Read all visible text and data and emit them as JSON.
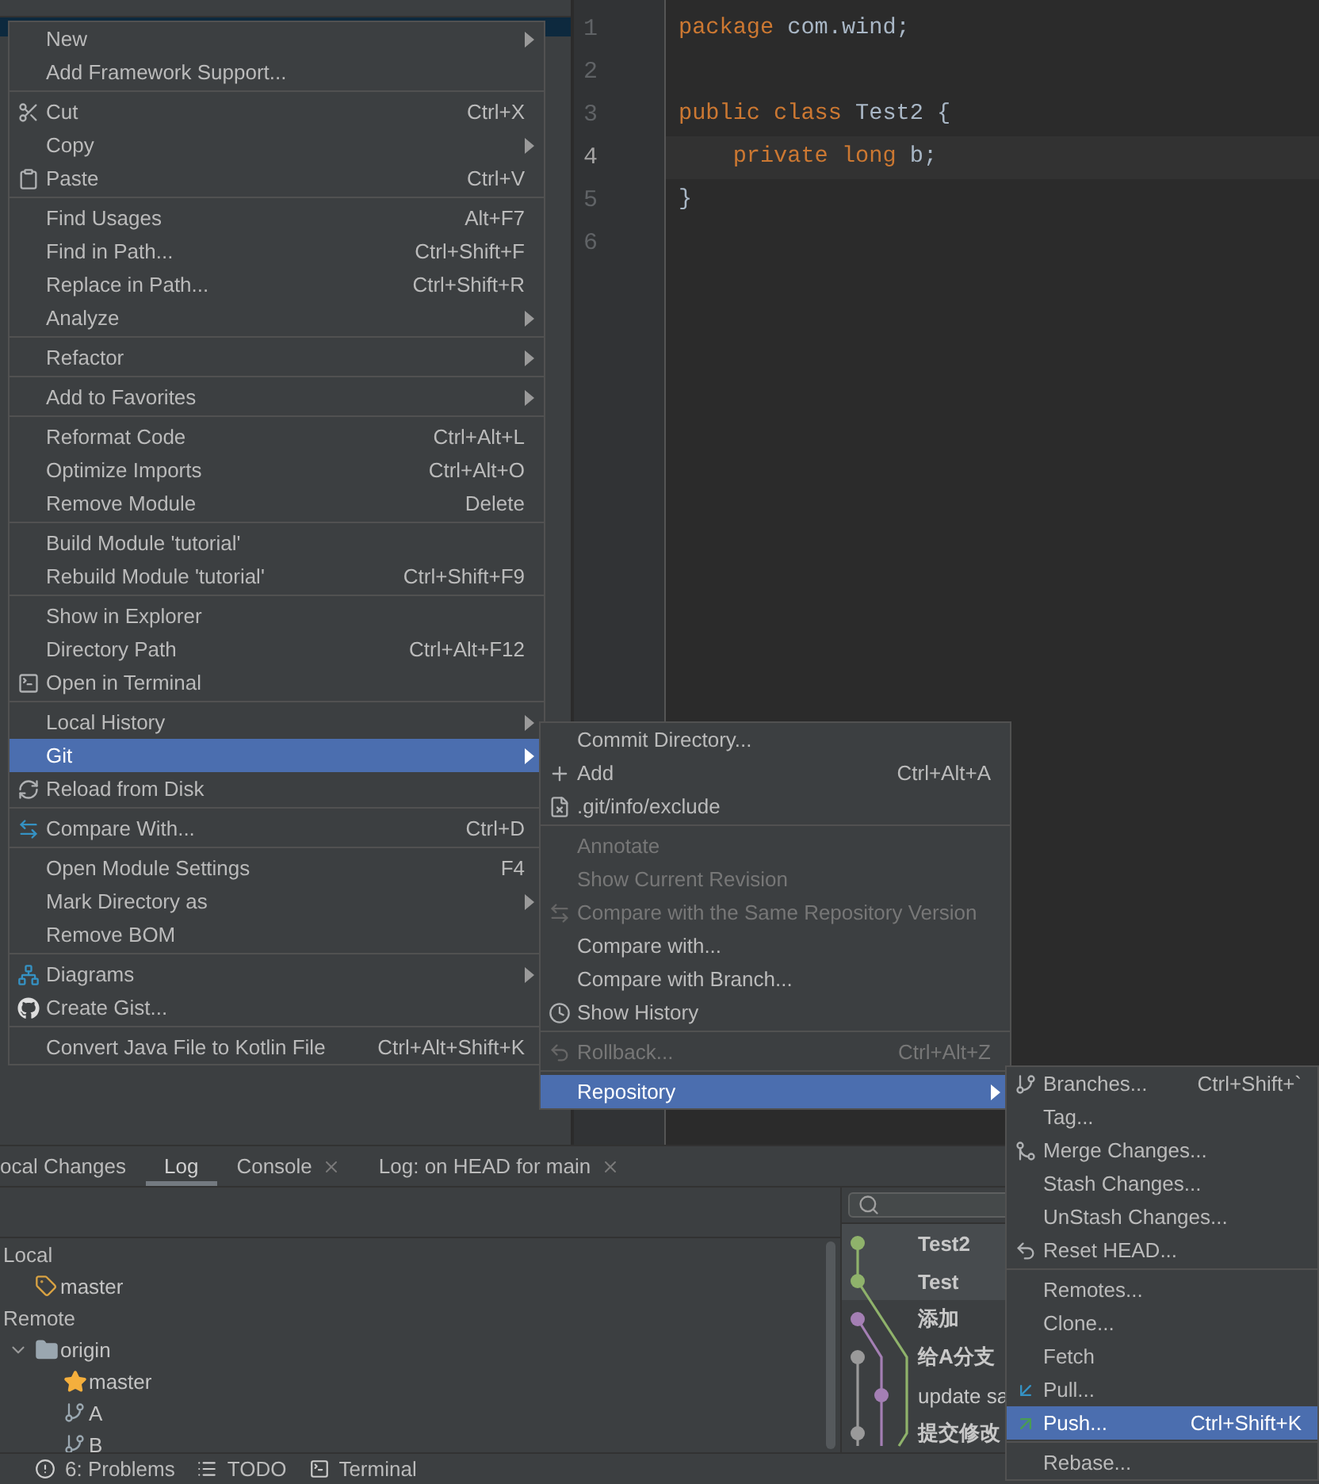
{
  "editor": {
    "lines": [
      {
        "number": "1",
        "current": false,
        "tokens": [
          {
            "kind": "keyword",
            "text": "package"
          },
          {
            "kind": "plain",
            "text": " com.wind;"
          }
        ]
      },
      {
        "number": "2",
        "current": false
      },
      {
        "number": "3",
        "current": false,
        "tokens": [
          {
            "kind": "keyword",
            "text": "public class"
          },
          {
            "kind": "plain",
            "text": " Test2 {"
          }
        ]
      },
      {
        "number": "4",
        "current": true,
        "tokens": [
          {
            "kind": "keyword",
            "text": "    private long"
          },
          {
            "kind": "plain",
            "text": " b;"
          }
        ]
      },
      {
        "number": "5",
        "current": false,
        "tokens": [
          {
            "kind": "plain",
            "text": "}"
          }
        ]
      },
      {
        "number": "6",
        "current": false
      }
    ]
  },
  "menus": [
    {
      "groups": [
        [
          {
            "label": "New",
            "submenu": true,
            "selected": false,
            "disabled": false
          },
          {
            "label": "Add Framework Support...",
            "submenu": false,
            "selected": false,
            "disabled": false
          }
        ],
        [
          {
            "label": "Cut",
            "shortcut": "Ctrl+X",
            "submenu": false,
            "selected": false,
            "disabled": false
          },
          {
            "label": "Copy",
            "submenu": true,
            "selected": false,
            "disabled": false
          },
          {
            "label": "Paste",
            "shortcut": "Ctrl+V",
            "submenu": false,
            "selected": false,
            "disabled": false
          }
        ],
        [
          {
            "label": "Find Usages",
            "shortcut": "Alt+F7",
            "submenu": false,
            "selected": false,
            "disabled": false
          },
          {
            "label": "Find in Path...",
            "shortcut": "Ctrl+Shift+F",
            "submenu": false,
            "selected": false,
            "disabled": false
          },
          {
            "label": "Replace in Path...",
            "shortcut": "Ctrl+Shift+R",
            "submenu": false,
            "selected": false,
            "disabled": false
          },
          {
            "label": "Analyze",
            "submenu": true,
            "selected": false,
            "disabled": false
          }
        ],
        [
          {
            "label": "Refactor",
            "submenu": true,
            "selected": false,
            "disabled": false
          }
        ],
        [
          {
            "label": "Add to Favorites",
            "submenu": true,
            "selected": false,
            "disabled": false
          }
        ],
        [
          {
            "label": "Reformat Code",
            "shortcut": "Ctrl+Alt+L",
            "submenu": false,
            "selected": false,
            "disabled": false
          },
          {
            "label": "Optimize Imports",
            "shortcut": "Ctrl+Alt+O",
            "submenu": false,
            "selected": false,
            "disabled": false
          },
          {
            "label": "Remove Module",
            "shortcut": "Delete",
            "submenu": false,
            "selected": false,
            "disabled": false
          }
        ],
        [
          {
            "label": "Build Module 'tutorial'",
            "submenu": false,
            "selected": false,
            "disabled": false
          },
          {
            "label": "Rebuild Module 'tutorial'",
            "shortcut": "Ctrl+Shift+F9",
            "submenu": false,
            "selected": false,
            "disabled": false
          }
        ],
        [
          {
            "label": "Show in Explorer",
            "submenu": false,
            "selected": false,
            "disabled": false
          },
          {
            "label": "Directory Path",
            "shortcut": "Ctrl+Alt+F12",
            "submenu": false,
            "selected": false,
            "disabled": false
          },
          {
            "label": "Open in Terminal",
            "submenu": false,
            "selected": false,
            "disabled": false
          }
        ],
        [
          {
            "label": "Local History",
            "submenu": true,
            "selected": false,
            "disabled": false
          },
          {
            "label": "Git",
            "submenu": true,
            "selected": true,
            "disabled": false
          },
          {
            "label": "Reload from Disk",
            "submenu": false,
            "selected": false,
            "disabled": false
          }
        ],
        [
          {
            "label": "Compare With...",
            "shortcut": "Ctrl+D",
            "submenu": false,
            "selected": false,
            "disabled": false
          }
        ],
        [
          {
            "label": "Open Module Settings",
            "shortcut": "F4",
            "submenu": false,
            "selected": false,
            "disabled": false
          },
          {
            "label": "Mark Directory as",
            "submenu": true,
            "selected": false,
            "disabled": false
          },
          {
            "label": "Remove BOM",
            "submenu": false,
            "selected": false,
            "disabled": false
          }
        ],
        [
          {
            "label": "Diagrams",
            "submenu": true,
            "selected": false,
            "disabled": false
          },
          {
            "label": "Create Gist...",
            "submenu": false,
            "selected": false,
            "disabled": false
          }
        ],
        [
          {
            "label": "Convert Java File to Kotlin File",
            "shortcut": "Ctrl+Alt+Shift+K",
            "submenu": false,
            "selected": false,
            "disabled": false
          }
        ]
      ]
    },
    {
      "groups": [
        [
          {
            "label": "Commit Directory...",
            "submenu": false,
            "selected": false,
            "disabled": false
          },
          {
            "label": "Add",
            "shortcut": "Ctrl+Alt+A",
            "submenu": false,
            "selected": false,
            "disabled": false
          },
          {
            "label": ".git/info/exclude",
            "submenu": false,
            "selected": false,
            "disabled": false
          }
        ],
        [
          {
            "label": "Annotate",
            "submenu": false,
            "selected": false,
            "disabled": true
          },
          {
            "label": "Show Current Revision",
            "submenu": false,
            "selected": false,
            "disabled": true
          },
          {
            "label": "Compare with the Same Repository Version",
            "submenu": false,
            "selected": false,
            "disabled": true
          },
          {
            "label": "Compare with...",
            "submenu": false,
            "selected": false,
            "disabled": false
          },
          {
            "label": "Compare with Branch...",
            "submenu": false,
            "selected": false,
            "disabled": false
          },
          {
            "label": "Show History",
            "submenu": false,
            "selected": false,
            "disabled": false
          }
        ],
        [
          {
            "label": "Rollback...",
            "shortcut": "Ctrl+Alt+Z",
            "submenu": false,
            "selected": false,
            "disabled": true
          }
        ],
        [
          {
            "label": "Repository",
            "submenu": true,
            "selected": true,
            "disabled": false
          }
        ]
      ]
    },
    {
      "groups": [
        [
          {
            "label": "Branches...",
            "shortcut": "Ctrl+Shift+`",
            "submenu": false,
            "selected": false,
            "disabled": false
          },
          {
            "label": "Tag...",
            "submenu": false,
            "selected": false,
            "disabled": false
          },
          {
            "label": "Merge Changes...",
            "submenu": false,
            "selected": false,
            "disabled": false
          },
          {
            "label": "Stash Changes...",
            "submenu": false,
            "selected": false,
            "disabled": false
          },
          {
            "label": "UnStash Changes...",
            "submenu": false,
            "selected": false,
            "disabled": false
          },
          {
            "label": "Reset HEAD...",
            "submenu": false,
            "selected": false,
            "disabled": false
          }
        ],
        [
          {
            "label": "Remotes...",
            "submenu": false,
            "selected": false,
            "disabled": false
          },
          {
            "label": "Clone...",
            "submenu": false,
            "selected": false,
            "disabled": false
          },
          {
            "label": "Fetch",
            "submenu": false,
            "selected": false,
            "disabled": false
          },
          {
            "label": "Pull...",
            "submenu": false,
            "selected": false,
            "disabled": false
          },
          {
            "label": "Push...",
            "shortcut": "Ctrl+Shift+K",
            "submenu": false,
            "selected": true,
            "disabled": false
          }
        ],
        [
          {
            "label": "Rebase...",
            "submenu": false,
            "selected": false,
            "disabled": false
          }
        ]
      ]
    }
  ],
  "bottom_panel": {
    "tabs": [
      {
        "label": "ocal Changes",
        "selected": false,
        "closable": false
      },
      {
        "label": "Log",
        "selected": true,
        "closable": false
      },
      {
        "label": "Console",
        "selected": false,
        "closable": true
      },
      {
        "label": "Log: on HEAD for main",
        "selected": false,
        "closable": true
      }
    ],
    "branches": [
      {
        "label": "Local",
        "kind": "group",
        "children": [
          {
            "label": "master",
            "kind": "tag"
          }
        ]
      },
      {
        "label": "Remote",
        "kind": "group",
        "children": [
          {
            "label": "origin",
            "kind": "folder",
            "expanded": true,
            "children": [
              {
                "label": "master",
                "kind": "star"
              },
              {
                "label": "A",
                "kind": "branch"
              },
              {
                "label": "B",
                "kind": "branch"
              }
            ]
          }
        ]
      }
    ],
    "commits": [
      {
        "message": "Test2",
        "bold": true,
        "highlighted": true,
        "color": "#8fb26b"
      },
      {
        "message": "Test",
        "bold": true,
        "highlighted": true,
        "color": "#8fb26b"
      },
      {
        "message": "添加",
        "bold": true,
        "highlighted": false,
        "color": "#a47fb4"
      },
      {
        "message": "给A分支",
        "bold": true,
        "highlighted": false,
        "color": "#9a9a9a"
      },
      {
        "message": "update sa",
        "bold": false,
        "highlighted": false,
        "color": "#a47fb4"
      },
      {
        "message": "提交修改",
        "bold": true,
        "highlighted": false,
        "color": "#9a9a9a"
      }
    ]
  },
  "status_bar": {
    "items": [
      {
        "label": "6: Problems"
      },
      {
        "label": "TODO"
      },
      {
        "label": "Terminal"
      }
    ]
  }
}
